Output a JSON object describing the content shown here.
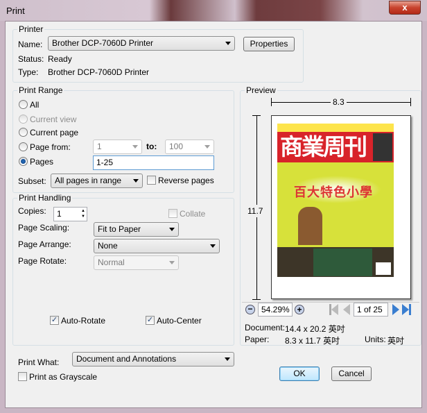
{
  "window": {
    "title": "Print",
    "close": "x"
  },
  "printer": {
    "group": "Printer",
    "name_label": "Name:",
    "name_value": "Brother DCP-7060D Printer",
    "properties": "Properties",
    "status_label": "Status:",
    "status_value": "Ready",
    "type_label": "Type:",
    "type_value": "Brother DCP-7060D Printer"
  },
  "range": {
    "group": "Print Range",
    "all": "All",
    "current_view": "Current view",
    "current_page": "Current page",
    "page_from": "Page from:",
    "from_value": "1",
    "to_label": "to:",
    "to_value": "100",
    "pages": "Pages",
    "pages_value": "1-25",
    "subset_label": "Subset:",
    "subset_value": "All pages in range",
    "reverse": "Reverse pages",
    "selected": "Pages"
  },
  "handling": {
    "group": "Print Handling",
    "copies_label": "Copies:",
    "copies_value": "1",
    "collate": "Collate",
    "scaling_label": "Page Scaling:",
    "scaling_value": "Fit to Paper",
    "arrange_label": "Page Arrange:",
    "arrange_value": "None",
    "rotate_label": "Page Rotate:",
    "rotate_value": "Normal",
    "auto_rotate": "Auto-Rotate",
    "auto_center": "Auto-Center",
    "auto_rotate_checked": true,
    "auto_center_checked": true
  },
  "preview": {
    "group": "Preview",
    "width": "8.3",
    "height": "11.7",
    "zoom": "54.29%",
    "page": "1 of 25",
    "doc_label": "Document:",
    "doc_value": "14.4 x 20.2 英吋",
    "paper_label": "Paper:",
    "paper_value": "8.3 x 11.7 英吋",
    "units_label": "Units:",
    "units_value": "英吋",
    "cover_title": "商業周刊",
    "cover_headline": "百大特色小學"
  },
  "bottom": {
    "what_label": "Print What:",
    "what_value": "Document and Annotations",
    "grayscale": "Print as Grayscale",
    "ok": "OK",
    "cancel": "Cancel"
  }
}
